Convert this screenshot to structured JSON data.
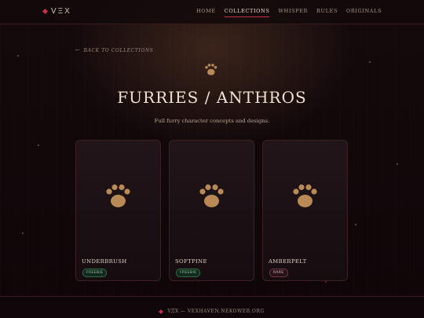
{
  "header": {
    "logo_text": "VΞX",
    "nav": [
      {
        "label": "Home",
        "active": false
      },
      {
        "label": "Collections",
        "active": true
      },
      {
        "label": "Whisper",
        "active": false
      },
      {
        "label": "Rules",
        "active": false
      },
      {
        "label": "Originals",
        "active": false
      }
    ]
  },
  "back_link": {
    "label": "Back to collections",
    "icon": "arrow-left-icon"
  },
  "page": {
    "icon": "paw-icon",
    "title": "Furries / Anthros",
    "subtitle": "Full furry character concepts and designs."
  },
  "cards": [
    {
      "name": "Underbrush",
      "badge": "Freebie",
      "badge_type": "free",
      "icon": "paw-icon"
    },
    {
      "name": "Softpine",
      "badge": "Freebie",
      "badge_type": "free",
      "icon": "paw-icon"
    },
    {
      "name": "Amberpelt",
      "badge": "Rare",
      "badge_type": "rare",
      "icon": "paw-icon"
    }
  ],
  "footer": {
    "text": "VΞX — vexhaven.nekoweb.org"
  },
  "colors": {
    "accent": "#c8304a",
    "paw": "#b98a56",
    "background": "#0f0709"
  }
}
